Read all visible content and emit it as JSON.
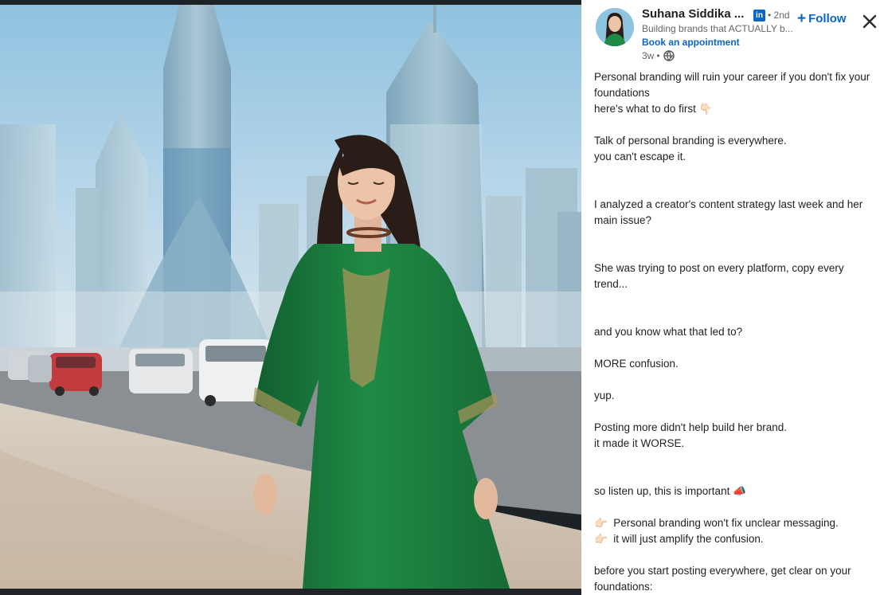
{
  "post_header": {
    "author_name": "Suhana Siddika ...",
    "network_badge": "in",
    "degree": "• 2nd",
    "follow_label": "Follow",
    "headline": "Building brands that ACTUALLY b...",
    "appointment_link": "Book an appointment",
    "age": "3w",
    "separator": "•",
    "visibility_icon": "globe-icon",
    "close_icon": "close-icon"
  },
  "post_body": [
    {
      "text": "Personal branding will ruin your career if you don't fix your foundations"
    },
    {
      "text": "here's what to do first 👇🏻"
    },
    {
      "blank": 1
    },
    {
      "text": "Talk of personal branding is everywhere."
    },
    {
      "text": "you can't escape it."
    },
    {
      "blank": 2
    },
    {
      "text": "I analyzed a creator's content strategy last week and her main issue?"
    },
    {
      "blank": 2
    },
    {
      "text": "She was trying to post on every platform, copy every trend..."
    },
    {
      "blank": 2
    },
    {
      "text": "and you know what that led to?"
    },
    {
      "blank": 1
    },
    {
      "text": "MORE confusion."
    },
    {
      "blank": 1
    },
    {
      "text": "yup."
    },
    {
      "blank": 1
    },
    {
      "text": "Posting more didn't help build her brand."
    },
    {
      "text": "it made it WORSE."
    },
    {
      "blank": 2
    },
    {
      "text": "so listen up, this is important 📣"
    },
    {
      "blank": 1
    },
    {
      "text": "👉🏻  Personal branding won't fix unclear messaging."
    },
    {
      "text": "👉🏻  it will just amplify the confusion."
    },
    {
      "blank": 1
    },
    {
      "text": "before you start posting everywhere, get clear on your foundations:"
    }
  ],
  "colors": {
    "link_blue": "#0a66c2",
    "dress_green": "#1f7a3e",
    "sky": "#a9cfe6",
    "text": "#1f1f1f",
    "muted": "#666666"
  }
}
